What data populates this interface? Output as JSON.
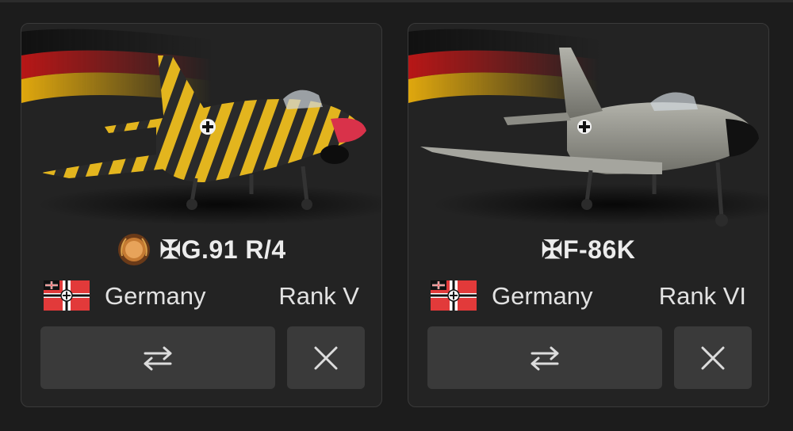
{
  "vehicles": [
    {
      "title": "✠G.91 R/4",
      "country": "Germany",
      "rank": "Rank V",
      "has_medal": true,
      "livery_colors": [
        "#e8b91c",
        "#2b2b2b"
      ],
      "swap_icon": "swap-arrows-icon",
      "close_icon": "close-icon"
    },
    {
      "title": "✠F-86K",
      "country": "Germany",
      "rank": "Rank VI",
      "has_medal": false,
      "livery_colors": [
        "#9a9a92",
        "#6d6d66"
      ],
      "swap_icon": "swap-arrows-icon",
      "close_icon": "close-icon"
    }
  ],
  "colors": {
    "background": "#1c1c1c",
    "card": "#232323",
    "button": "#3a3a3a",
    "text": "#e6e6e6"
  }
}
